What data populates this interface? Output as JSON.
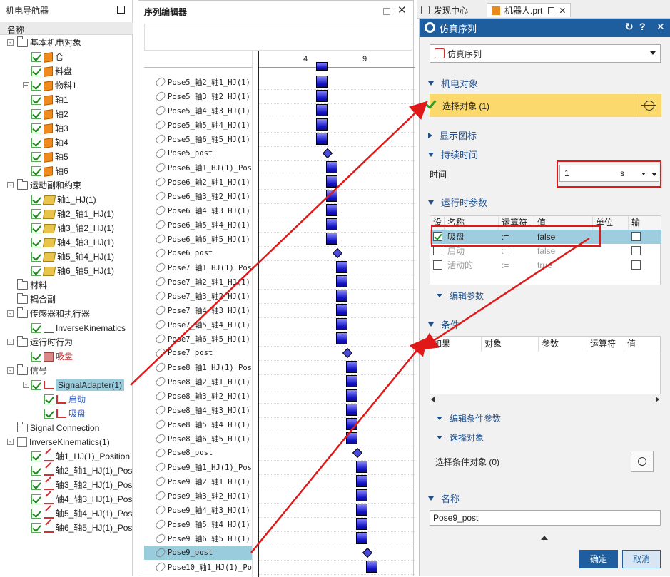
{
  "navigator": {
    "title": "机电导航器",
    "column_header": "名称",
    "nodes": [
      {
        "label": "基本机电对象",
        "level": 0,
        "icon": "folder-icon",
        "toggle": "-"
      },
      {
        "label": "仓",
        "level": 1,
        "icon": "cube-icon",
        "checked": true
      },
      {
        "label": "料盘",
        "level": 1,
        "icon": "cube-icon",
        "checked": true
      },
      {
        "label": "物料1",
        "level": 1,
        "icon": "cube-icon",
        "checked": true,
        "toggle": "+"
      },
      {
        "label": "轴1",
        "level": 1,
        "icon": "cube-icon",
        "checked": true
      },
      {
        "label": "轴2",
        "level": 1,
        "icon": "cube-icon",
        "checked": true
      },
      {
        "label": "轴3",
        "level": 1,
        "icon": "cube-icon",
        "checked": true
      },
      {
        "label": "轴4",
        "level": 1,
        "icon": "cube-icon",
        "checked": true
      },
      {
        "label": "轴5",
        "level": 1,
        "icon": "cube-icon",
        "checked": true
      },
      {
        "label": "轴6",
        "level": 1,
        "icon": "cube-icon",
        "checked": true
      },
      {
        "label": "运动副和约束",
        "level": 0,
        "icon": "folder-icon",
        "toggle": "-"
      },
      {
        "label": "轴1_HJ(1)",
        "level": 1,
        "icon": "hinge-joint-icon",
        "checked": true
      },
      {
        "label": "轴2_轴1_HJ(1)",
        "level": 1,
        "icon": "hinge-joint-icon",
        "checked": true
      },
      {
        "label": "轴3_轴2_HJ(1)",
        "level": 1,
        "icon": "hinge-joint-icon",
        "checked": true
      },
      {
        "label": "轴4_轴3_HJ(1)",
        "level": 1,
        "icon": "hinge-joint-icon",
        "checked": true
      },
      {
        "label": "轴5_轴4_HJ(1)",
        "level": 1,
        "icon": "hinge-joint-icon",
        "checked": true
      },
      {
        "label": "轴6_轴5_HJ(1)",
        "level": 1,
        "icon": "hinge-joint-icon",
        "checked": true
      },
      {
        "label": "材料",
        "level": 0,
        "icon": "folder-icon"
      },
      {
        "label": "耦合副",
        "level": 0,
        "icon": "folder-icon"
      },
      {
        "label": "传感器和执行器",
        "level": 0,
        "icon": "folder-icon",
        "toggle": "-"
      },
      {
        "label": "InverseKinematics",
        "level": 1,
        "icon": "ik-icon",
        "checked": true
      },
      {
        "label": "运行时行为",
        "level": 0,
        "icon": "folder-icon",
        "toggle": "-"
      },
      {
        "label": "吸盘",
        "level": 1,
        "icon": "runtime-behavior-icon",
        "checked": true,
        "style": "red"
      },
      {
        "label": "信号",
        "level": 0,
        "icon": "folder-icon",
        "toggle": "-"
      },
      {
        "label": "SignalAdapter(1)",
        "level": 1,
        "icon": "signal-adapter-icon",
        "checked": true,
        "toggle": "-",
        "selected": true
      },
      {
        "label": "启动",
        "level": 2,
        "icon": "signal-icon",
        "checked": true,
        "style": "blue"
      },
      {
        "label": "吸盘",
        "level": 2,
        "icon": "signal-icon",
        "checked": true,
        "style": "blue"
      },
      {
        "label": "Signal Connection",
        "level": 0,
        "icon": "folder-icon"
      },
      {
        "label": "InverseKinematics(1)",
        "level": 0,
        "icon": "doc-icon",
        "toggle": "-"
      },
      {
        "label": "轴1_HJ(1)_Position",
        "level": 1,
        "icon": "position-control-icon",
        "checked": true
      },
      {
        "label": "轴2_轴1_HJ(1)_Pos",
        "level": 1,
        "icon": "position-control-icon",
        "checked": true
      },
      {
        "label": "轴3_轴2_HJ(1)_Pos",
        "level": 1,
        "icon": "position-control-icon",
        "checked": true
      },
      {
        "label": "轴4_轴3_HJ(1)_Pos",
        "level": 1,
        "icon": "position-control-icon",
        "checked": true
      },
      {
        "label": "轴5_轴4_HJ(1)_Pos",
        "level": 1,
        "icon": "position-control-icon",
        "checked": true
      },
      {
        "label": "轴6_轴5_HJ(1)_Pos",
        "level": 1,
        "icon": "position-control-icon",
        "checked": true
      }
    ]
  },
  "sequence_editor": {
    "title": "序列编辑器",
    "ruler_ticks": [
      "4",
      "9"
    ],
    "rows": [
      "Pose5_轴2_轴1_HJ(1)",
      "Pose5_轴3_轴2_HJ(1)",
      "Pose5_轴4_轴3_HJ(1)",
      "Pose5_轴5_轴4_HJ(1)",
      "Pose5_轴6_轴5_HJ(1)",
      "Pose5_post",
      "Pose6_轴1_HJ(1)_Pos",
      "Pose6_轴2_轴1_HJ(1)",
      "Pose6_轴3_轴2_HJ(1)",
      "Pose6_轴4_轴3_HJ(1)",
      "Pose6_轴5_轴4_HJ(1)",
      "Pose6_轴6_轴5_HJ(1)",
      "Pose6_post",
      "Pose7_轴1_HJ(1)_Pos",
      "Pose7_轴2_轴1_HJ(1)",
      "Pose7_轴3_轴2_HJ(1)",
      "Pose7_轴4_轴3_HJ(1)",
      "Pose7_轴5_轴4_HJ(1)",
      "Pose7_轴6_轴5_HJ(1)",
      "Pose7_post",
      "Pose8_轴1_HJ(1)_Pos",
      "Pose8_轴2_轴1_HJ(1)",
      "Pose8_轴3_轴2_HJ(1)",
      "Pose8_轴4_轴3_HJ(1)",
      "Pose8_轴5_轴4_HJ(1)",
      "Pose8_轴6_轴5_HJ(1)",
      "Pose8_post",
      "Pose9_轴1_HJ(1)_Pos",
      "Pose9_轴2_轴1_HJ(1)",
      "Pose9_轴3_轴2_HJ(1)",
      "Pose9_轴4_轴3_HJ(1)",
      "Pose9_轴5_轴4_HJ(1)",
      "Pose9_轴6_轴5_HJ(1)",
      "Pose9_post",
      "Pose10_轴1_HJ(1)_Po"
    ],
    "selected_row": "Pose9_post"
  },
  "tabs": [
    {
      "label": "发现中心"
    },
    {
      "label": "机器人.prt"
    }
  ],
  "dialog": {
    "title": "仿真序列",
    "type_value": "仿真序列",
    "mech_section": "机电对象",
    "select_object": "选择对象 (1)",
    "display_icon_section": "显示图标",
    "duration_section": "持续时间",
    "time_label": "时间",
    "time_value": "1",
    "time_unit": "s",
    "runtime_section": "运行时参数",
    "param_headers": {
      "set": "设",
      "name": "名称",
      "op": "运算符",
      "value": "值",
      "unit": "单位",
      "out": "输"
    },
    "params": [
      {
        "set": true,
        "name": "吸盘",
        "op": ":=",
        "value": "false",
        "out": false,
        "selected": true
      },
      {
        "set": false,
        "name": "启动",
        "op": ":=",
        "value": "false",
        "out": false
      },
      {
        "set": false,
        "name": "活动的",
        "op": ":=",
        "value": "true",
        "out": false
      }
    ],
    "edit_params": "编辑参数",
    "condition_section": "条件",
    "cond_headers": [
      "如果",
      "对象",
      "参数",
      "运算符",
      "值"
    ],
    "edit_cond_params": "编辑条件参数",
    "select_object_sub": "选择对象",
    "select_cond_object": "选择条件对象 (0)",
    "name_section": "名称",
    "name_value": "Pose9_post",
    "ok": "确定",
    "cancel": "取消"
  }
}
